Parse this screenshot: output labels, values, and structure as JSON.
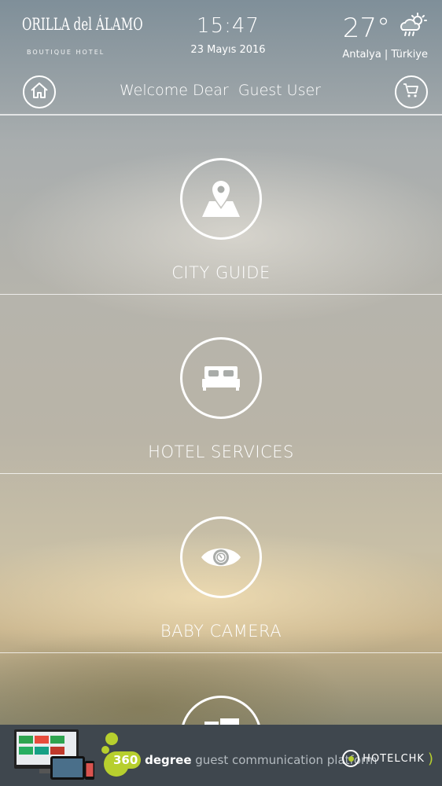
{
  "header": {
    "logo_main": "ORILLA del ÁLAMO",
    "logo_sub": "BOUTIQUE HOTEL",
    "time": "15:47",
    "date": "23 Mayıs 2016",
    "temperature": "27°",
    "location": "Antalya | Türkiye",
    "weather_icon": "partly-cloudy-rain-icon",
    "welcome_prefix": "Welcome Dear",
    "user_name": "Guest User"
  },
  "menu": {
    "items": [
      {
        "label": "CITY GUIDE",
        "icon": "map-pin-icon"
      },
      {
        "label": "HOTEL SERVICES",
        "icon": "bed-icon"
      },
      {
        "label": "BABY CAMERA",
        "icon": "eye-camera-icon"
      }
    ]
  },
  "footer": {
    "brand_number": "360",
    "brand_word": "degree",
    "brand_tagline": "guest communication platform",
    "partner": "HOTELCHK",
    "accent_color": "#b7cf2e"
  }
}
